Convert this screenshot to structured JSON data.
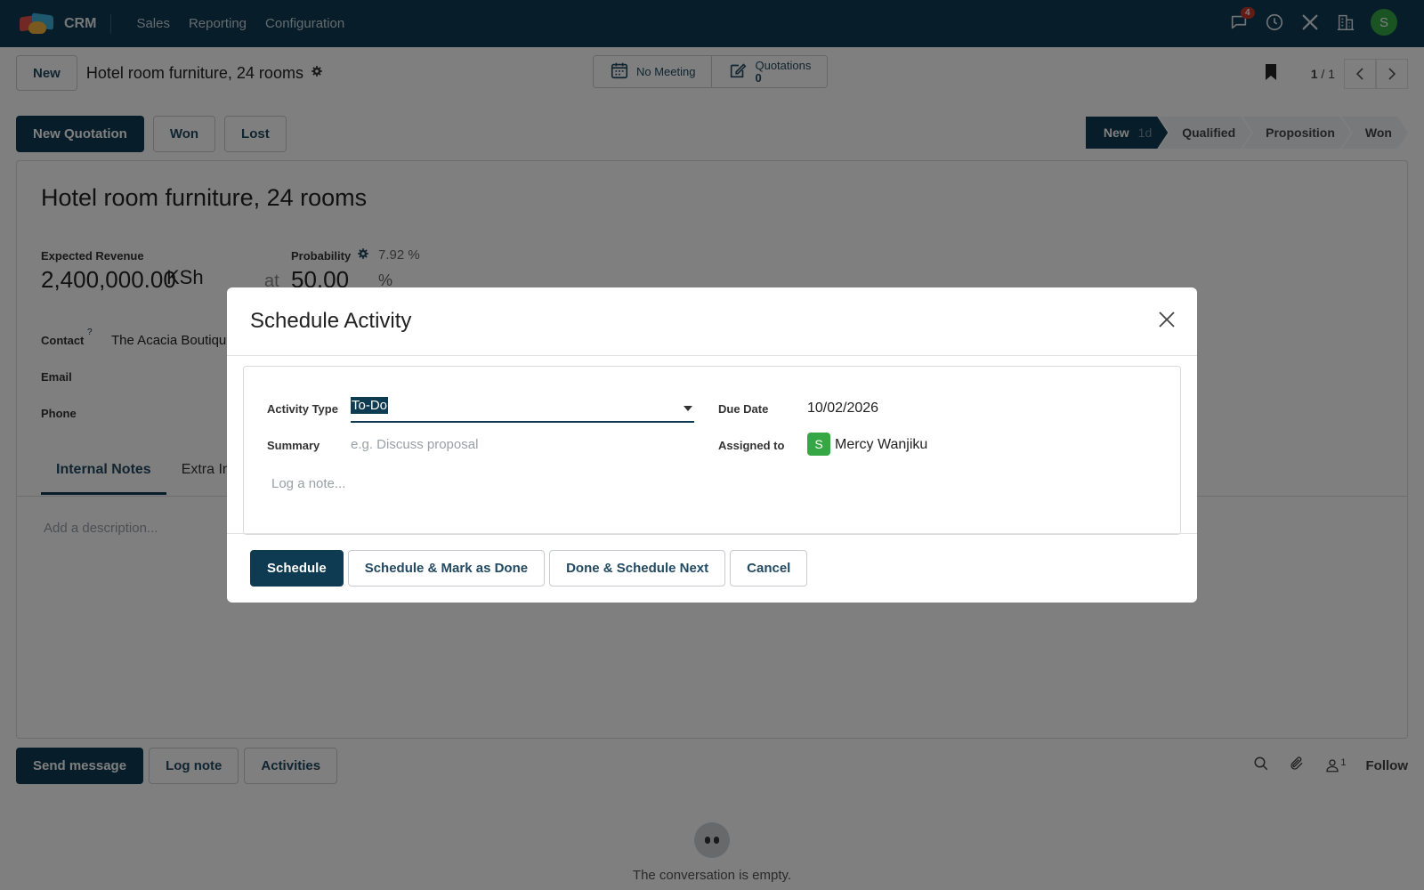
{
  "topnav": {
    "app_name": "CRM",
    "menus": [
      "Sales",
      "Reporting",
      "Configuration"
    ],
    "messages_badge": "4",
    "user_initial": "S"
  },
  "control": {
    "new_label": "New",
    "record_title": "Hotel room furniture, 24 rooms",
    "smart_meeting": "No Meeting",
    "smart_quotations_label": "Quotations",
    "smart_quotations_count": "0",
    "pager_current": "1",
    "pager_sep": " / ",
    "pager_total": "1",
    "buttons": {
      "new_quotation": "New Quotation",
      "won": "Won",
      "lost": "Lost"
    },
    "stages": [
      {
        "label": "New",
        "days": "1d",
        "active": true
      },
      {
        "label": "Qualified"
      },
      {
        "label": "Proposition"
      },
      {
        "label": "Won"
      }
    ]
  },
  "form": {
    "title": "Hotel room furniture, 24 rooms",
    "expected_revenue_label": "Expected Revenue",
    "expected_revenue_value": "2,400,000.00",
    "currency": "KSh",
    "at": "at",
    "probability_label": "Probability",
    "probability_auto": "7.92 %",
    "probability_value": "50.00",
    "probability_unit": "%",
    "contact_label": "Contact",
    "contact_help": "?",
    "contact_value": "The Acacia Boutiqu",
    "email_label": "Email",
    "phone_label": "Phone",
    "tabs": [
      "Internal Notes",
      "Extra Inf"
    ],
    "description_placeholder": "Add a description..."
  },
  "chatter": {
    "send_message": "Send message",
    "log_note": "Log note",
    "activities": "Activities",
    "followers_count": "1",
    "follow": "Follow",
    "empty_text": "The conversation is empty."
  },
  "modal": {
    "title": "Schedule Activity",
    "activity_type_label": "Activity Type",
    "activity_type_value": "To-Do",
    "summary_label": "Summary",
    "summary_placeholder": "e.g. Discuss proposal",
    "due_date_label": "Due Date",
    "due_date_value": "10/02/2026",
    "assigned_to_label": "Assigned to",
    "assigned_to_initial": "S",
    "assigned_to_value": "Mercy Wanjiku",
    "note_placeholder": "Log a note...",
    "buttons": {
      "schedule": "Schedule",
      "schedule_done": "Schedule & Mark as Done",
      "done_next": "Done & Schedule Next",
      "cancel": "Cancel"
    }
  },
  "colors": {
    "brand": "#0e3a52",
    "avatar": "#35a845",
    "badge": "#c0392b"
  }
}
